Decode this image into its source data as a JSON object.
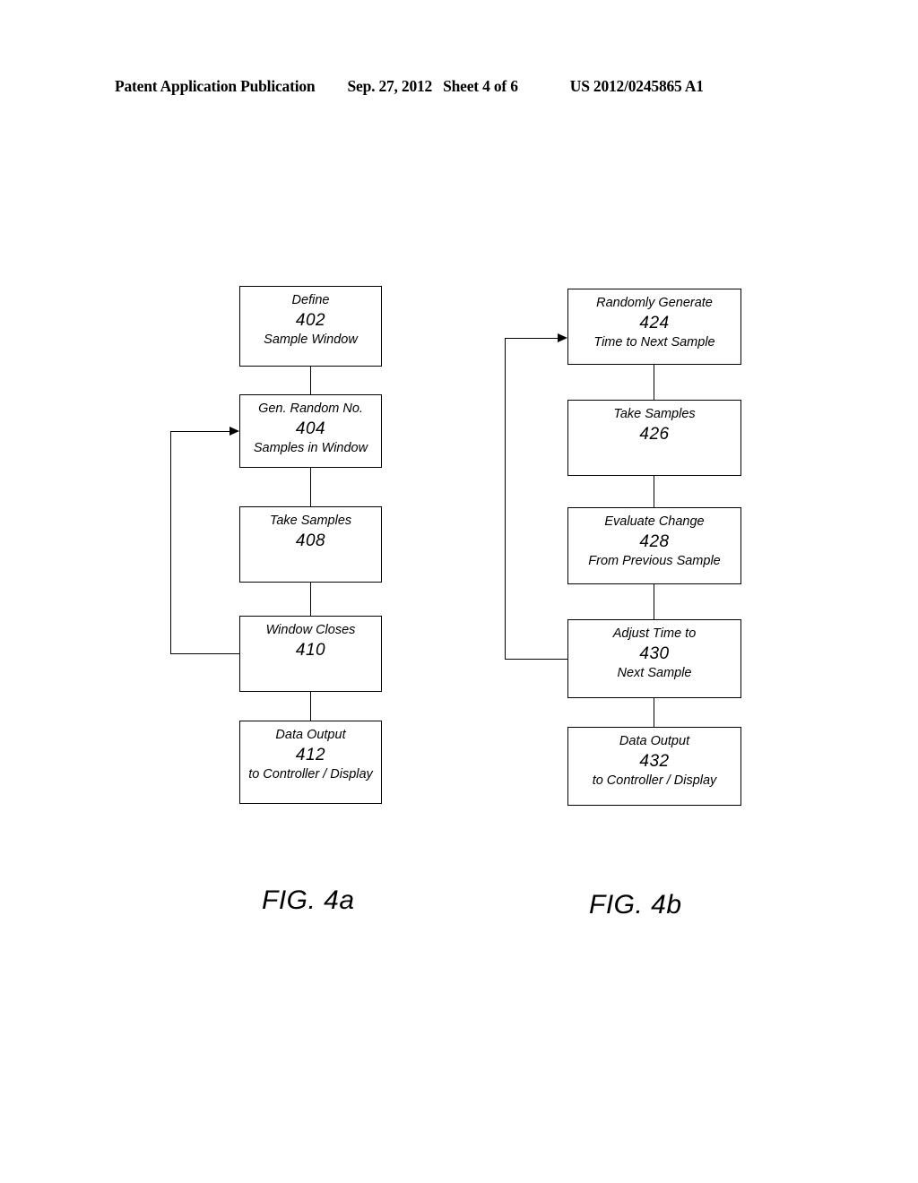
{
  "header": {
    "publication": "Patent Application Publication",
    "date": "Sep. 27, 2012",
    "sheet": "Sheet 4 of 6",
    "patent_number": "US 2012/0245865 A1"
  },
  "figures": [
    {
      "caption": "FIG. 4a",
      "boxes": [
        {
          "id": "402",
          "line1": "Define",
          "number": "402",
          "line3": "Sample Window"
        },
        {
          "id": "404",
          "line1": "Gen. Random No.",
          "number": "404",
          "line3": "Samples in Window"
        },
        {
          "id": "408",
          "line1": "Take Samples",
          "number": "408",
          "line3": ""
        },
        {
          "id": "410",
          "line1": "Window Closes",
          "number": "410",
          "line3": ""
        },
        {
          "id": "412",
          "line1": "Data Output",
          "number": "412",
          "line3": "to Controller / Display"
        }
      ],
      "feedback": {
        "from_box": "410",
        "to_box": "404"
      }
    },
    {
      "caption": "FIG. 4b",
      "boxes": [
        {
          "id": "424",
          "line1": "Randomly Generate",
          "number": "424",
          "line3": "Time to Next Sample"
        },
        {
          "id": "426",
          "line1": "Take Samples",
          "number": "426",
          "line3": ""
        },
        {
          "id": "428",
          "line1": "Evaluate Change",
          "number": "428",
          "line3": "From Previous Sample"
        },
        {
          "id": "430",
          "line1": "Adjust Time to",
          "number": "430",
          "line3": "Next Sample"
        },
        {
          "id": "432",
          "line1": "Data Output",
          "number": "432",
          "line3": "to Controller / Display"
        }
      ],
      "feedback": {
        "from_box": "430",
        "to_box": "424"
      }
    }
  ]
}
